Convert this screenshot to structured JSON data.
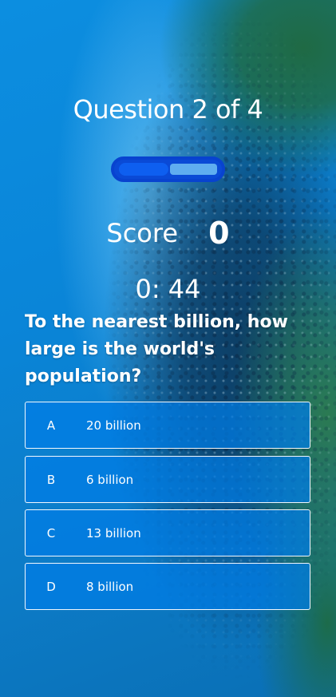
{
  "quiz": {
    "title": "Question 2 of 4",
    "progress": 0.5,
    "score_label": "Score",
    "score_value": "0",
    "timer": "0: 44",
    "question": "To the nearest billion, how large is the world's population?",
    "answers": [
      {
        "letter": "A",
        "text": "20 billion"
      },
      {
        "letter": "B",
        "text": "6 billion"
      },
      {
        "letter": "C",
        "text": "13 billion"
      },
      {
        "letter": "D",
        "text": "8 billion"
      }
    ]
  },
  "colors": {
    "progress_track": "#0a4ad6",
    "progress_fill": "#0e5ff0",
    "progress_remaining": "#6ebef5",
    "answer_bg": "#007de6",
    "text": "#ffffff"
  }
}
